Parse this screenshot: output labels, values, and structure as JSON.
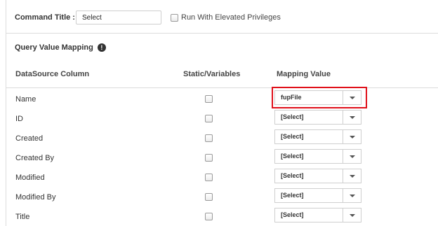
{
  "command": {
    "title_label": "Command Title :",
    "title_value": "Select",
    "elevated_label": "Run With Elevated Privileges"
  },
  "mapping": {
    "section_title": "Query Value Mapping",
    "info_glyph": "!",
    "headers": {
      "datasource": "DataSource Column",
      "static": "Static/Variables",
      "mapping": "Mapping Value"
    },
    "rows": [
      {
        "name": "Name",
        "value": "fupFile"
      },
      {
        "name": "ID",
        "value": "[Select]"
      },
      {
        "name": "Created",
        "value": "[Select]"
      },
      {
        "name": "Created By",
        "value": "[Select]"
      },
      {
        "name": "Modified",
        "value": "[Select]"
      },
      {
        "name": "Modified By",
        "value": "[Select]"
      },
      {
        "name": "Title",
        "value": "[Select]"
      }
    ]
  },
  "colors": {
    "highlight_border": "#e0101a",
    "border": "#dcdcdc"
  }
}
